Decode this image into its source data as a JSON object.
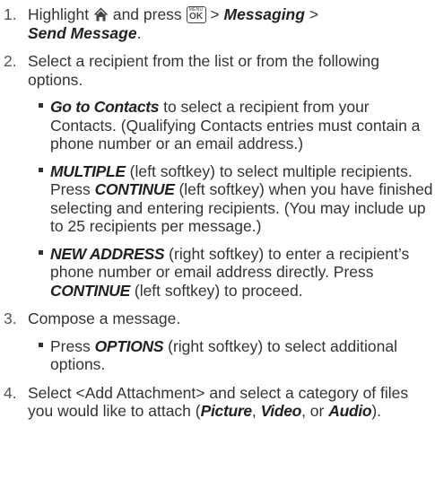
{
  "steps": [
    {
      "num": "1.",
      "t1": "Highlight ",
      "t2": " and press ",
      "key_menu": "MENU",
      "key_ok": "OK",
      "t3": " > ",
      "e1": "Messaging",
      "t4": " > ",
      "e2": "Send Message",
      "t5": "."
    },
    {
      "num": "2.",
      "text": "Select a recipient from the list or from the following options.",
      "bullets": [
        {
          "e": "Go to Contacts",
          "t": " to select a recipient from your Contacts. (Qualifying Contacts entries must contain a phone number or an email address.)"
        },
        {
          "e": "MULTIPLE",
          "t": " (left softkey) to select multiple recipients. Press ",
          "e2": "CONTINUE",
          "t2": " (left softkey) when you have finished selecting and entering recipients. (You may include up to 25 recipients per message.)"
        },
        {
          "e": "NEW ADDRESS",
          "t": " (right softkey) to enter a recipient’s phone number or email address directly. Press ",
          "e2": "CONTINUE",
          "t2": " (left softkey) to proceed."
        }
      ]
    },
    {
      "num": "3.",
      "text": "Compose a message.",
      "bullets": [
        {
          "t0": "Press ",
          "e": "OPTIONS",
          "t": " (right softkey) to select additional options."
        }
      ]
    },
    {
      "num": "4.",
      "t1": "Select <Add Attachment> and select a category of files you would like to attach (",
      "e1": "Picture",
      "t2": ", ",
      "e2": "Video",
      "t3": ", or ",
      "e3": "Audio",
      "t4": ")."
    }
  ]
}
